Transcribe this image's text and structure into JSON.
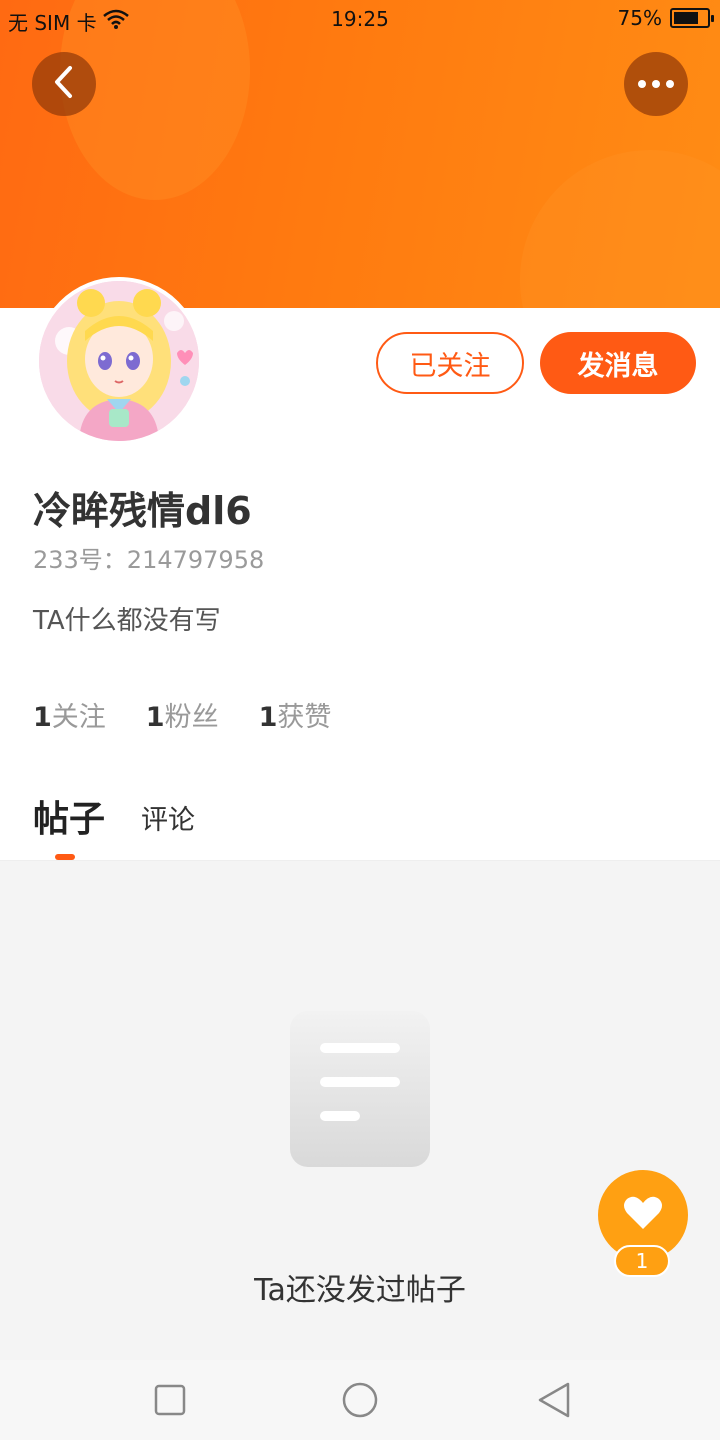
{
  "status_bar": {
    "carrier": "无 SIM 卡",
    "time": "19:25",
    "battery_percent_label": "75%",
    "battery_level": 0.75,
    "icons": [
      "wifi-icon",
      "battery-icon"
    ]
  },
  "header": {
    "back_icon": "chevron-left-icon",
    "more_icon": "more-dots-icon",
    "accent_color": "#ff5a14"
  },
  "profile": {
    "name": "冷眸残情dl6",
    "uid": "233号：214797958",
    "bio": "TA什么都没有写",
    "follow_button": "已关注",
    "message_button": "发消息"
  },
  "stats": [
    {
      "num": "1",
      "label": "关注"
    },
    {
      "num": "1",
      "label": "粉丝"
    },
    {
      "num": "1",
      "label": "获赞"
    }
  ],
  "tabs": [
    {
      "label": "帖子",
      "active": true
    },
    {
      "label": "评论",
      "active": false
    }
  ],
  "empty_state": {
    "icon": "document-icon",
    "text": "Ta还没发过帖子"
  },
  "fab": {
    "icon": "heart-icon",
    "badge": "1",
    "color": "#ffa012"
  },
  "nav_bar": {
    "icons": [
      "square-recent-icon",
      "circle-home-icon",
      "triangle-back-icon"
    ]
  }
}
